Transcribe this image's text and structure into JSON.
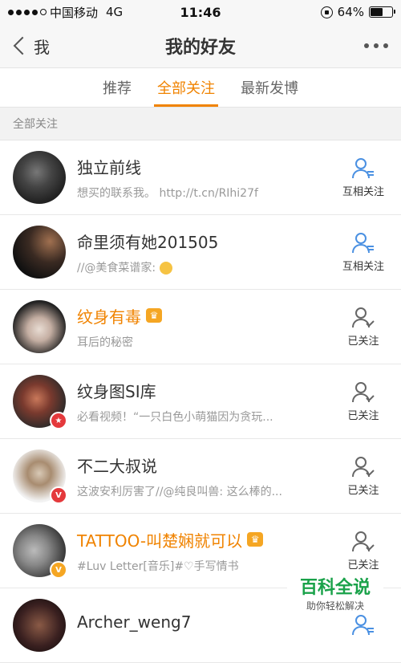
{
  "status": {
    "carrier": "中国移动",
    "network": "4G",
    "time": "11:46",
    "battery": "64%",
    "battery_level": 0.64
  },
  "nav": {
    "back_label": "我",
    "title": "我的好友"
  },
  "tabs": [
    {
      "label": "推荐",
      "active": false
    },
    {
      "label": "全部关注",
      "active": true
    },
    {
      "label": "最新发博",
      "active": false
    }
  ],
  "section": {
    "label": "全部关注"
  },
  "friends": [
    {
      "name": "独立前线",
      "desc": "想买的联系我。 http://t.cn/RIhi27f",
      "action": "互相关注",
      "mutual": true
    },
    {
      "name": "命里须有她201505",
      "desc": "//@美食菜谱家:",
      "action": "互相关注",
      "mutual": true
    },
    {
      "name": "纹身有毒",
      "desc": "耳后的秘密",
      "action": "已关注",
      "mutual": false
    },
    {
      "name": "纹身图SI库",
      "desc": "必看视频！“一只白色小萌猫因为贪玩...",
      "action": "已关注",
      "mutual": false
    },
    {
      "name": "不二大叔说",
      "desc": "这波安利厉害了//@纯良叫兽: 这么棒的...",
      "action": "已关注",
      "mutual": false
    },
    {
      "name": "TATTOO-叫楚娴就可以",
      "desc": "#Luv Letter[音乐]#♡手写情书",
      "action": "已关注",
      "mutual": false
    },
    {
      "name": "Archer_weng7",
      "desc": "",
      "action": "",
      "mutual": true
    }
  ],
  "watermark": {
    "title": "百科全说",
    "subtitle": "助你轻松解决"
  },
  "colors": {
    "accent": "#f08300",
    "mutual_icon": "#4a90e2",
    "check_icon": "#666666"
  }
}
